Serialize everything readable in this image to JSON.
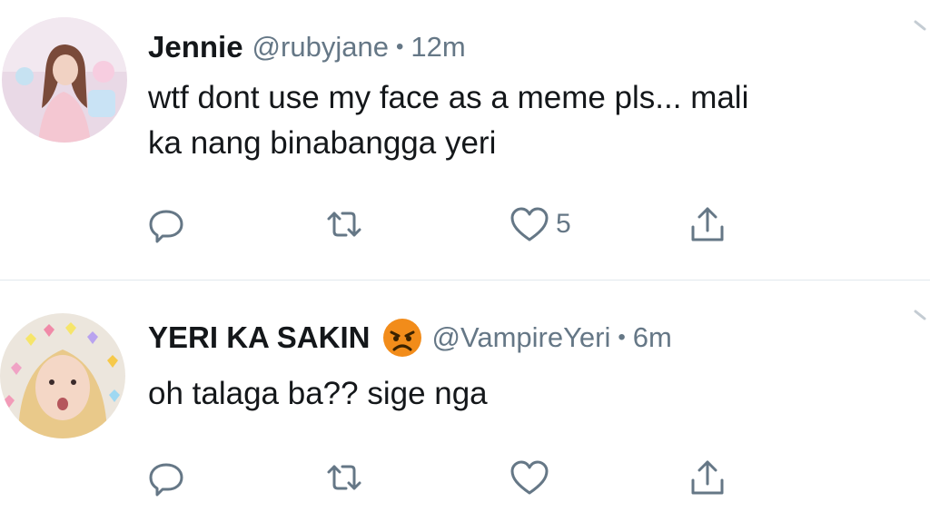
{
  "tweets": [
    {
      "name": "Jennie",
      "handle": "@rubyjane",
      "separator": "•",
      "time": "12m",
      "text_lines": [
        "wtf dont use my face as a meme pls... mali",
        "ka nang binabangga yeri"
      ],
      "likes": "5"
    },
    {
      "name": "YERI KA SAKIN",
      "emoji": "angry-face-emoji",
      "handle": "@VampireYeri",
      "separator": "•",
      "time": "6m",
      "text_lines": [
        "oh talaga ba?? sige nga"
      ],
      "likes": ""
    }
  ],
  "icons": {
    "reply": "reply-icon",
    "retweet": "retweet-icon",
    "like": "heart-icon",
    "share": "share-icon"
  },
  "colors": {
    "text": "#14171a",
    "secondary": "#657786",
    "divider": "#e1e8ed",
    "emoji": "#f28c1a"
  }
}
